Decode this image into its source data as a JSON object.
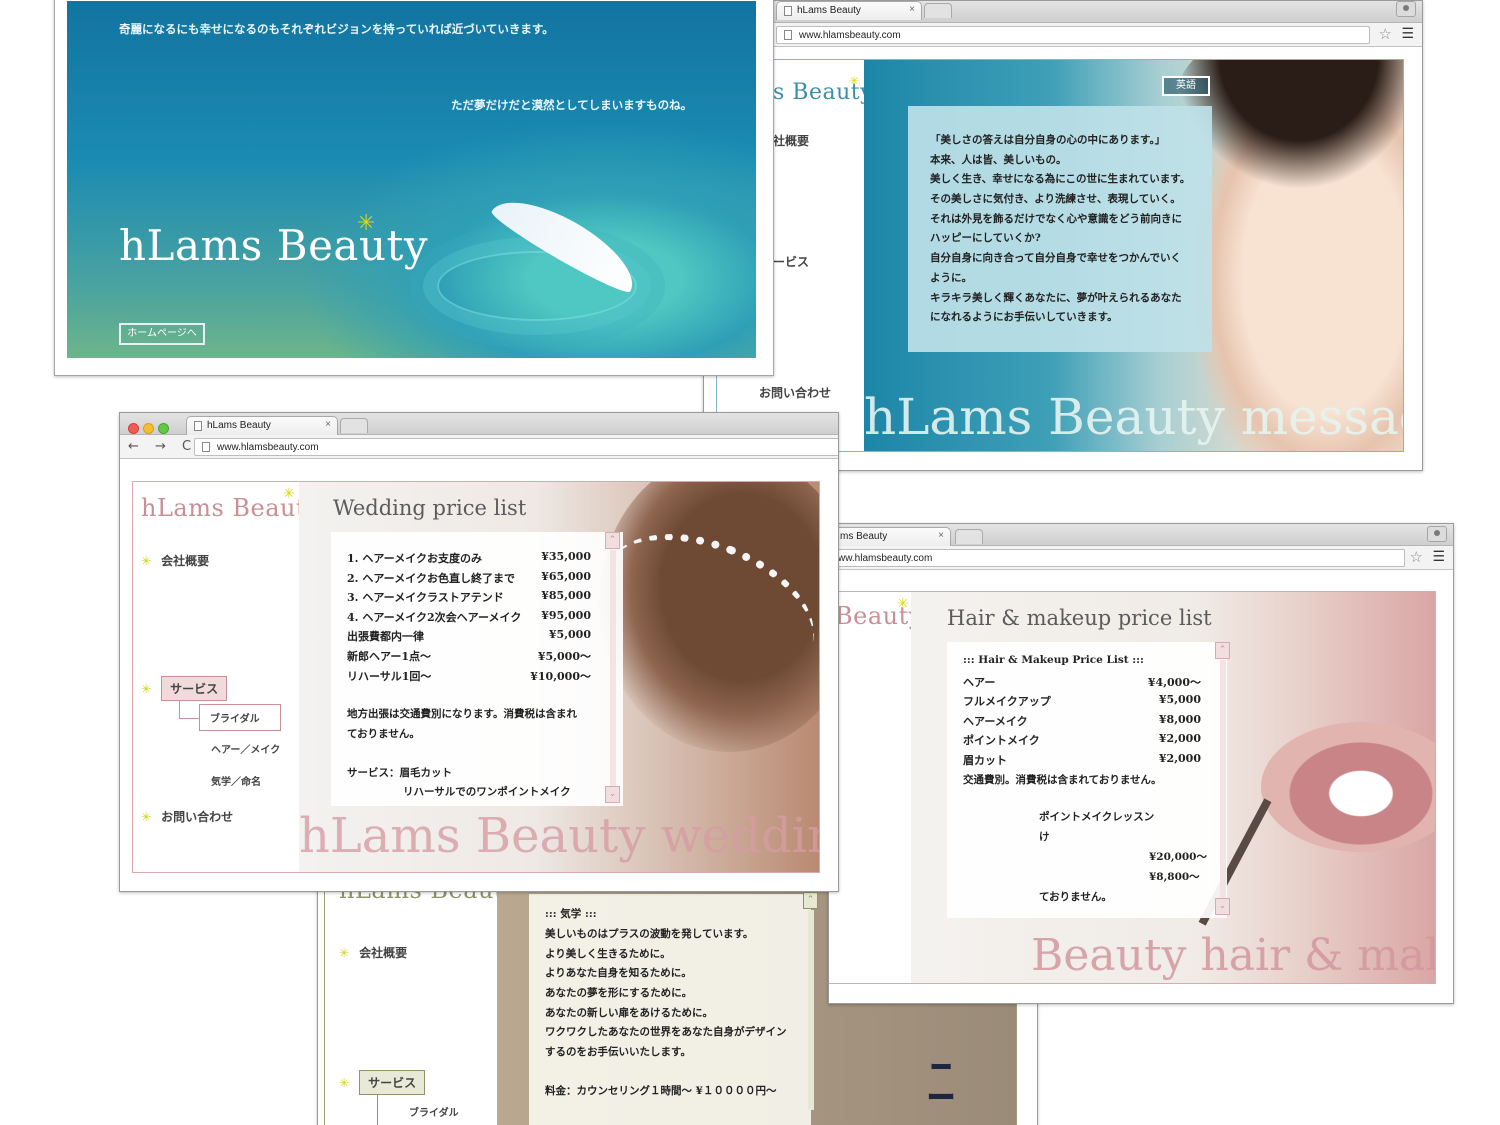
{
  "window_intro": {
    "line1": "奇麗になるにも幸せになるのもそれぞれビジョンを持っていれば近づいていきます。",
    "line2": "ただ夢だけだと漠然としてしまいますものね。",
    "logo": "hLams Beauty",
    "home_button": "ホームページへ"
  },
  "window_message": {
    "tab_title": "hLams Beauty",
    "tab_close": "×",
    "url": "www.hlamsbeauty.com",
    "logo_partial": "s Beauty",
    "nav": [
      "社概要",
      "ービス",
      "お問い合わせ"
    ],
    "english_button": "英語",
    "message_lines": [
      "「美しさの答えは自分自身の心の中にあります。」",
      "本来、人は皆、美しいもの。",
      "美しく生き、幸せになる為にこの世に生まれています。",
      "その美しさに気付き、より洗練させ、表現していく。",
      "それは外見を飾るだけでなく心や意識をどう前向きに",
      "ハッピーにしていくか?",
      "自分自身に向き合って自分自身で幸せをつかんでいく",
      "ように。",
      "キラキラ美しく輝くあなたに、夢が叶えられるあなた",
      "になれるようにお手伝いしていきます。"
    ],
    "big_title": "hLams Beauty message"
  },
  "window_wedding": {
    "tab_title": "hLams Beauty",
    "tab_close": "×",
    "url": "www.hlamsbeauty.com",
    "nav_buttons": "← → C",
    "logo": "hLams Beauty",
    "nav": {
      "company": "会社概要",
      "service": "サービス",
      "bridal": "ブライダル",
      "hair_make": "ヘアー／メイク",
      "kigaku": "気学／命名",
      "contact": "お問い合わせ"
    },
    "heading": "Wedding price list",
    "prices": [
      {
        "item": "1. ヘアーメイクお支度のみ",
        "price": "¥35,000"
      },
      {
        "item": "2. ヘアーメイクお色直し終了まで",
        "price": "¥65,000"
      },
      {
        "item": "3. ヘアーメイクラストアテンド",
        "price": "¥85,000"
      },
      {
        "item": "4. ヘアーメイク2次会ヘアーメイク",
        "price": "¥95,000"
      },
      {
        "item": "出張費都内一律",
        "price": "¥5,000"
      },
      {
        "item": "新郎ヘアー1点〜",
        "price": "¥5,000〜"
      },
      {
        "item": "リハーサル1回〜",
        "price": "¥10,000〜"
      }
    ],
    "note_lines": [
      "地方出張は交通費別になります。消費税は含まれ",
      "ておりません。"
    ],
    "service_line1": "サービス：眉毛カット",
    "service_line2": "リハーサルでのワンポイントメイク",
    "big_title": "hLams Beauty wedding"
  },
  "window_hair": {
    "tab_title": "ms Beauty",
    "tab_close": "×",
    "url": "ww.hlamsbeauty.com",
    "logo_partial": "Beauty",
    "heading": "Hair & makeup price list",
    "list_title": "::: Hair & Makeup Price List :::",
    "prices": [
      {
        "item": "ヘアー",
        "price": "¥4,000〜"
      },
      {
        "item": "フルメイクアップ",
        "price": "¥5,000"
      },
      {
        "item": "ヘアーメイク",
        "price": "¥8,000"
      },
      {
        "item": "ポイントメイク",
        "price": "¥2,000"
      },
      {
        "item": "眉カット",
        "price": "¥2,000"
      }
    ],
    "note": "交通費別。消費税は含まれておりません。",
    "lesson_line": "ポイントメイクレッスン",
    "lesson_line2": "け",
    "lesson_price1": "¥20,000〜",
    "lesson_price2": "¥8,800〜",
    "lesson_note": "ておりません。",
    "big_title": "Beauty hair & makeup"
  },
  "window_kigaku": {
    "logo": "hLams Beauty",
    "nav": {
      "company": "会社概要",
      "service": "サービス",
      "bridal": "ブライダル"
    },
    "title": "::: 気学 :::",
    "lines": [
      "美しいものはプラスの波動を発しています。",
      "より美しく生きるために。",
      "よりあなた自身を知るために。",
      "あなたの夢を形にするために。",
      "あなたの新しい扉をあけるために。",
      "ワクワクしたあなたの世界をあなた自身がデザイン",
      "するのをお手伝いいたします。"
    ],
    "fee": "料金：カウンセリング１時間〜 ¥１００００円〜"
  },
  "colors": {
    "pink_accent": "#c98f96",
    "olive_accent": "#8f9468",
    "teal_bg": "#1c86a8",
    "spark_yellow": "#d8d80a"
  }
}
